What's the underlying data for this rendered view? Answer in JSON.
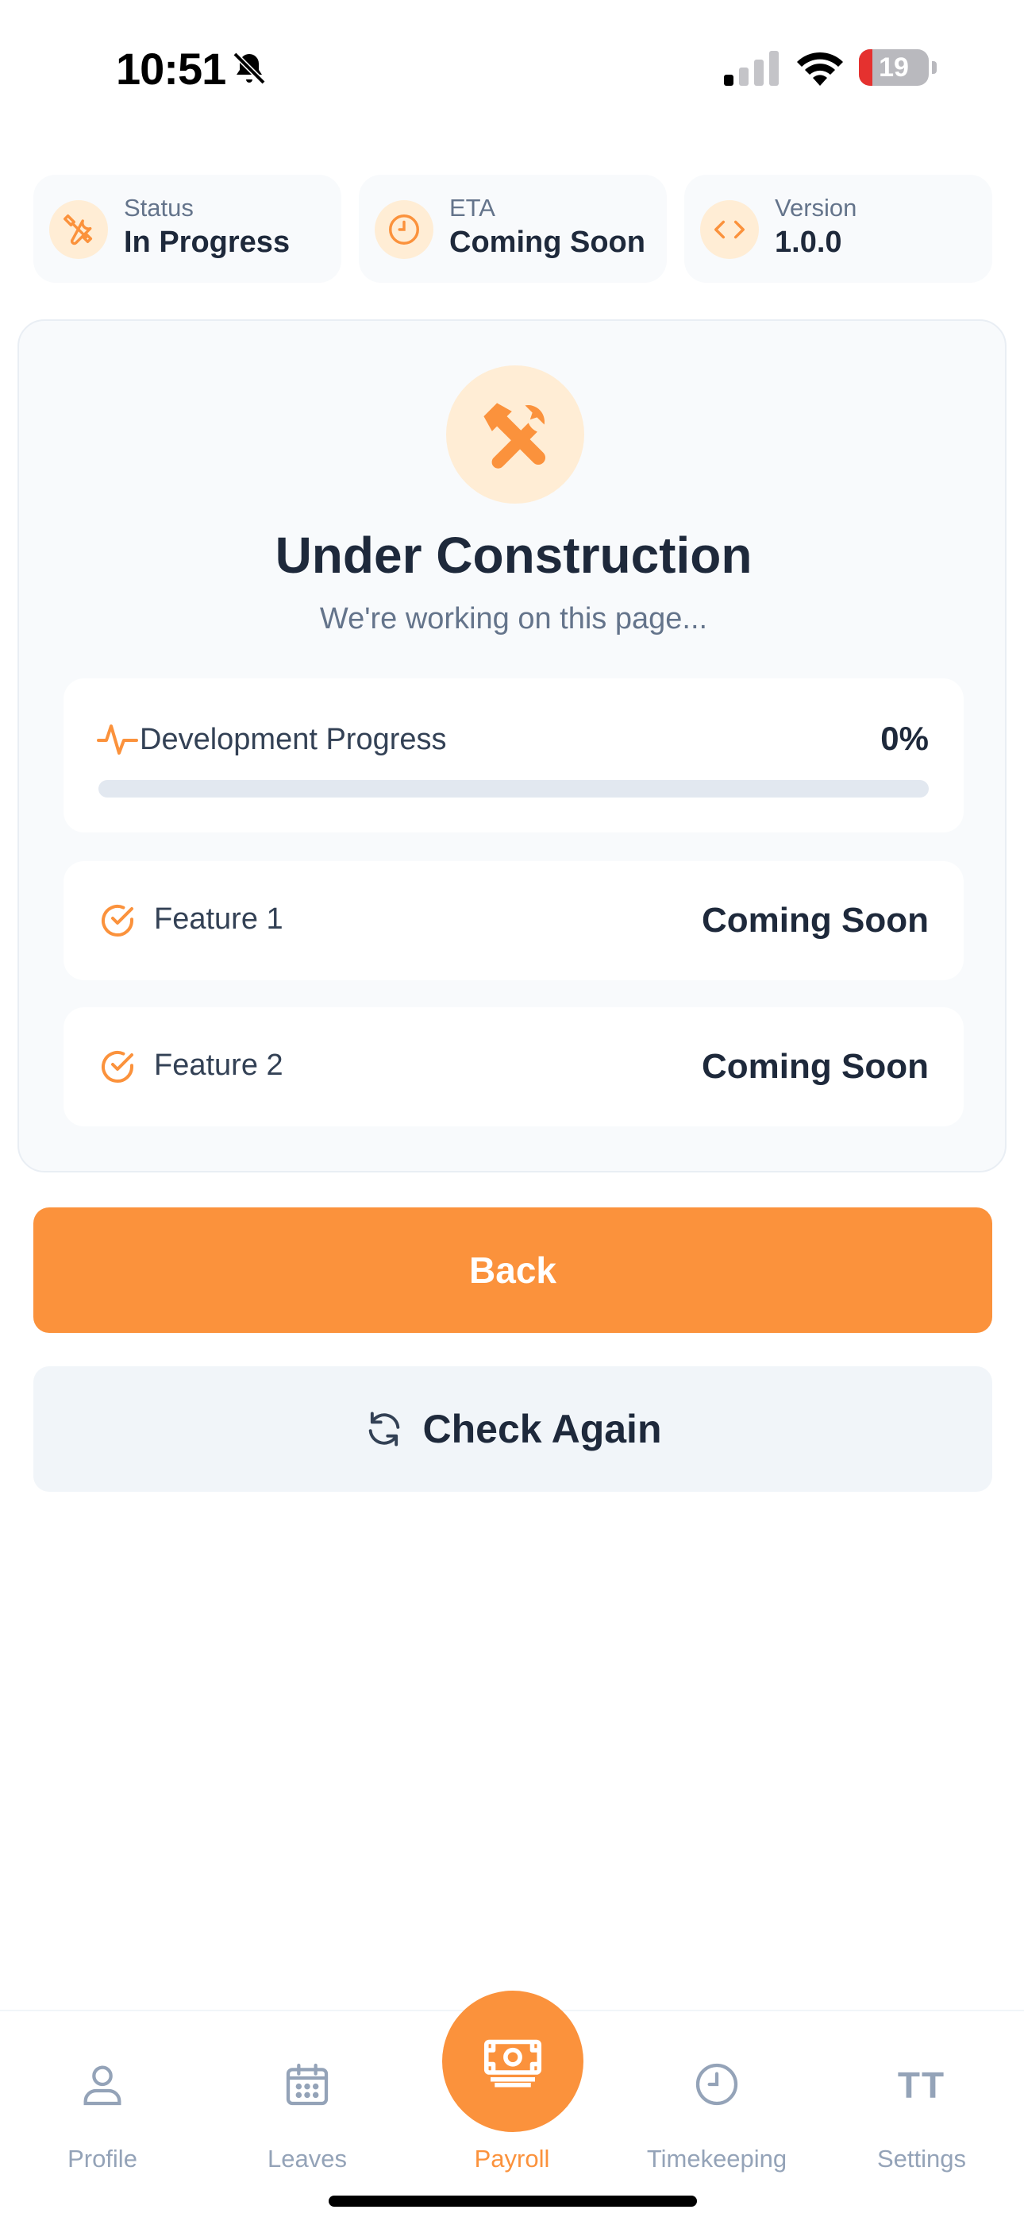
{
  "status_bar": {
    "time": "10:51",
    "battery_level": "19",
    "battery_fraction": 0.19
  },
  "info_cards": [
    {
      "label": "Status",
      "value": "In Progress",
      "icon": "tools-icon"
    },
    {
      "label": "ETA",
      "value": "Coming Soon",
      "icon": "clock-icon"
    },
    {
      "label": "Version",
      "value": "1.0.0",
      "icon": "code-icon"
    }
  ],
  "main": {
    "title": "Under Construction",
    "subtitle": "We're working on this page...",
    "progress": {
      "label": "Development Progress",
      "value_text": "0%",
      "percent": 0
    },
    "features": [
      {
        "name": "Feature 1",
        "status": "Coming Soon"
      },
      {
        "name": "Feature 2",
        "status": "Coming Soon"
      }
    ]
  },
  "buttons": {
    "back": "Back",
    "check_again": "Check Again"
  },
  "nav": {
    "items": [
      {
        "label": "Profile",
        "icon": "person-icon"
      },
      {
        "label": "Leaves",
        "icon": "calendar-icon"
      },
      {
        "label": "Payroll",
        "icon": "money-icon",
        "active": true
      },
      {
        "label": "Timekeeping",
        "icon": "clock-icon"
      },
      {
        "label": "Settings",
        "icon": "settings-icon",
        "glyph": "TT"
      }
    ]
  },
  "colors": {
    "accent": "#fb923c",
    "accent_light": "#ffedd5",
    "text_primary": "#1e293b",
    "text_muted": "#64748b"
  }
}
